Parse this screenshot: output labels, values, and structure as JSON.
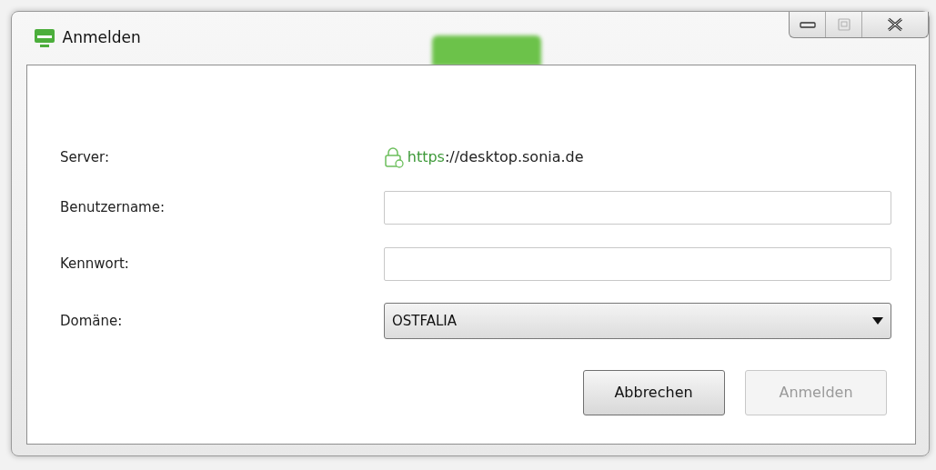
{
  "window": {
    "title": "Anmelden",
    "controls": [
      {
        "kind": "minimize",
        "disabled": false
      },
      {
        "kind": "maximize",
        "disabled": true
      },
      {
        "kind": "close",
        "disabled": false
      }
    ]
  },
  "server": {
    "label": "Server:",
    "scheme": "https",
    "rest": "://desktop.sonia.de",
    "secure": true
  },
  "fields": [
    {
      "kind": "text",
      "label": "Benutzername:"
    },
    {
      "kind": "password",
      "label": "Kennwort:"
    },
    {
      "kind": "select",
      "label": "Domäne:",
      "value": "OSTFALIA"
    }
  ],
  "buttons": [
    {
      "label": "Abbrechen",
      "disabled": false
    },
    {
      "label": "Anmelden",
      "disabled": true
    }
  ]
}
